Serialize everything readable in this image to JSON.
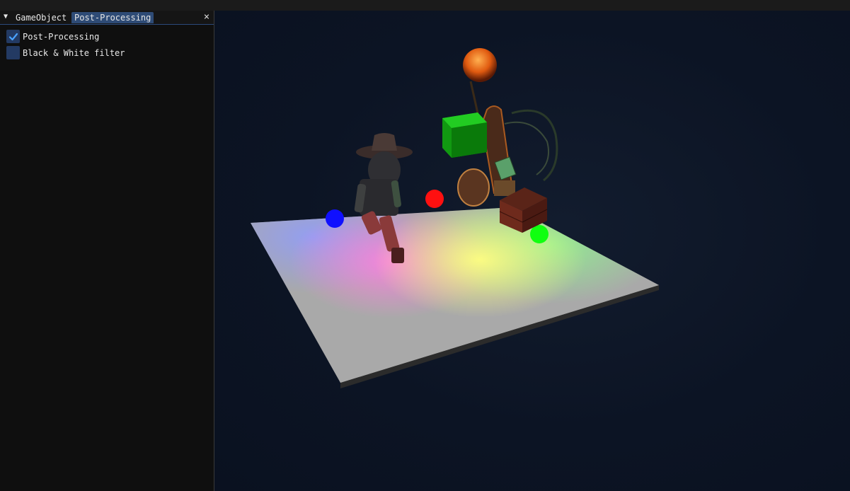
{
  "panel": {
    "collapse_glyph": "▼",
    "tabs": [
      {
        "label": "GameObject",
        "active": false
      },
      {
        "label": "Post-Processing",
        "active": true
      }
    ],
    "close_glyph": "×",
    "options": [
      {
        "label": "Post-Processing",
        "checked": true
      },
      {
        "label": "Black & White filter",
        "checked": false
      }
    ]
  },
  "scene": {
    "lights": {
      "blue": "#1010ff",
      "red": "#ff1010",
      "green": "#10ff10",
      "orange": "#ff7a10"
    },
    "icons": [
      "collapse-icon",
      "close-icon",
      "checkmark-icon"
    ]
  }
}
